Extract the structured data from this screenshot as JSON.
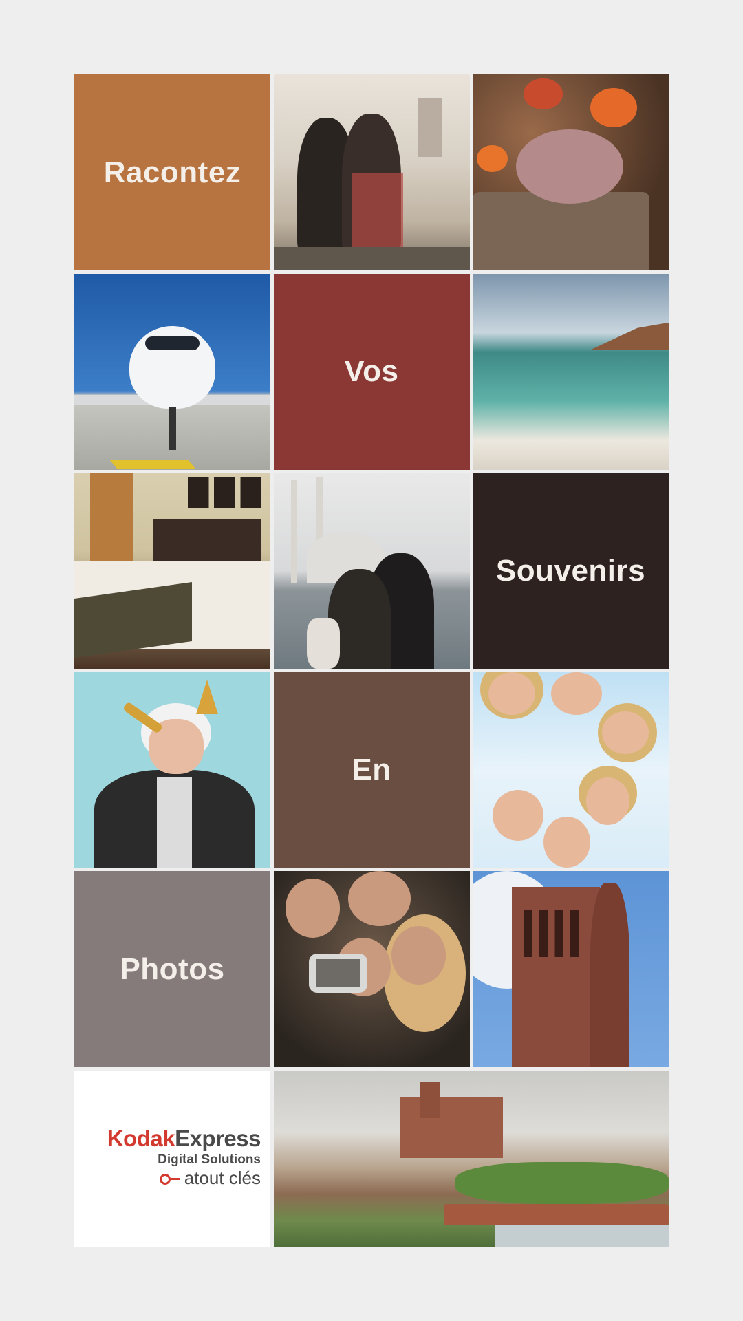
{
  "words": {
    "w1": "Racontez",
    "w2": "Vos",
    "w3": "Souvenirs",
    "w4": "En",
    "w5": "Photos"
  },
  "colors": {
    "w1": "#b87440",
    "w2": "#8b3734",
    "w3": "#2e2221",
    "w4": "#6a4e42",
    "w5": "#857b7b"
  },
  "logo": {
    "brand_kodak": "Kodak",
    "brand_express": "Express",
    "line2": "Digital Solutions",
    "line3": "atout clés"
  }
}
